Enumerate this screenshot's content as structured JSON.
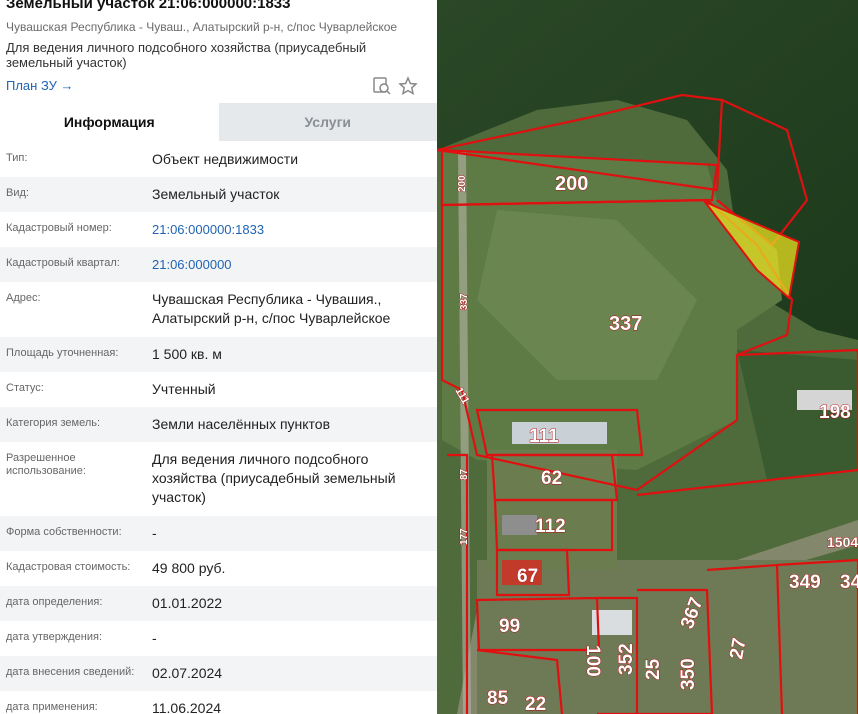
{
  "header": {
    "title": "Земельный участок 21:06:000000:1833",
    "subtitle": "Чувашская Республика - Чуваш., Алатырский р-н, с/пос Чуварлейское",
    "purpose": "Для ведения личного подсобного хозяйства (приусадебный земельный участок)",
    "plan_link": "План ЗУ →"
  },
  "tabs": [
    {
      "label": "Информация",
      "active": true
    },
    {
      "label": "Услуги",
      "active": false
    }
  ],
  "rows": [
    {
      "label": "Тип:",
      "value": "Объект недвижимости"
    },
    {
      "label": "Вид:",
      "value": "Земельный участок"
    },
    {
      "label": "Кадастровый номер:",
      "value": "21:06:000000:1833",
      "link": true
    },
    {
      "label": "Кадастровый квартал:",
      "value": "21:06:000000",
      "link": true
    },
    {
      "label": "Адрес:",
      "value": "Чувашская Республика - Чувашия., Алатырский р-н, с/пос Чуварлейское"
    },
    {
      "label": "Площадь уточненная:",
      "value": "1 500 кв. м"
    },
    {
      "label": "Статус:",
      "value": "Учтенный"
    },
    {
      "label": "Категория земель:",
      "value": "Земли населённых пунктов"
    },
    {
      "label": "Разрешенное использование:",
      "value": "Для ведения личного подсобного хозяйства (приусадебный земельный участок)"
    },
    {
      "label": "Форма собственности:",
      "value": "-"
    },
    {
      "label": "Кадастровая стоимость:",
      "value": "49 800 руб."
    },
    {
      "label": "дата определения:",
      "value": "01.01.2022"
    },
    {
      "label": "дата утверждения:",
      "value": "-"
    },
    {
      "label": "дата внесения сведений:",
      "value": "02.07.2024"
    },
    {
      "label": "дата применения:",
      "value": "11.06.2024"
    }
  ],
  "map": {
    "parcel_labels": [
      "200",
      "200",
      "337",
      "337",
      "111",
      "111",
      "198",
      "87",
      "62",
      "112",
      "177",
      "67",
      "1504",
      "349",
      "34",
      "99",
      "100",
      "367",
      "352",
      "25",
      "350",
      "27",
      "85",
      "22"
    ],
    "boundary_color": "#e01010",
    "selected_fill": "#e8e020"
  }
}
